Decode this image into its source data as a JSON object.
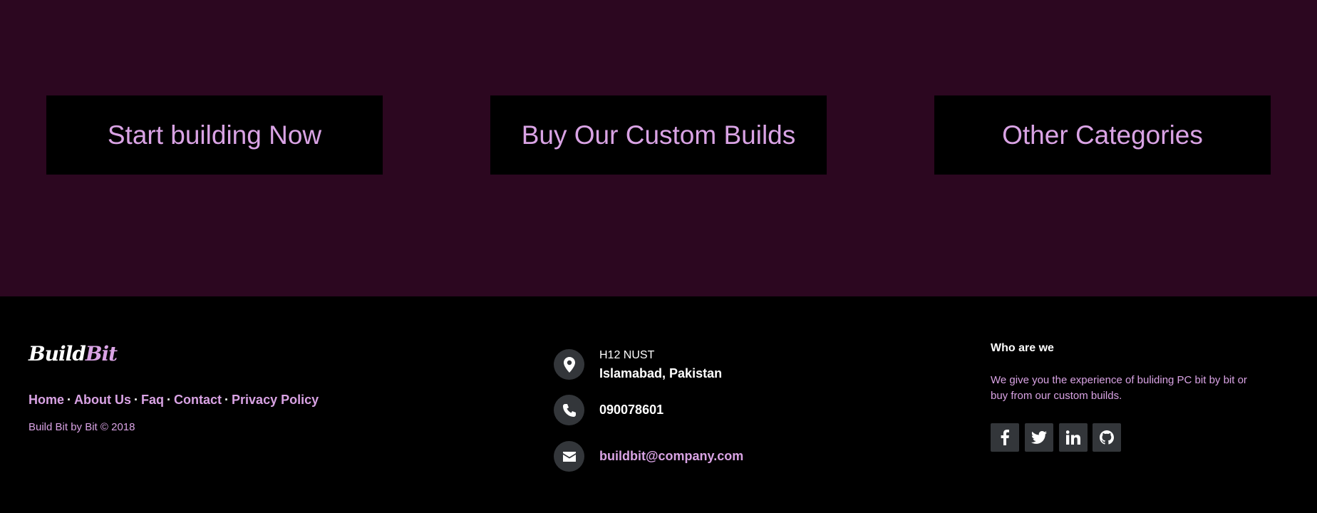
{
  "hero": {
    "buttons": [
      {
        "label": "Start building Now"
      },
      {
        "label": "Buy Our Custom Builds"
      },
      {
        "label": "Other Categories"
      }
    ]
  },
  "footer": {
    "brand": {
      "part1": "Build",
      "part2": "Bit"
    },
    "links": [
      {
        "label": "Home"
      },
      {
        "label": "About Us"
      },
      {
        "label": "Faq"
      },
      {
        "label": "Contact"
      },
      {
        "label": "Privacy Policy"
      }
    ],
    "separator": "·",
    "copyright": "Build Bit by Bit © 2018",
    "contact": {
      "address_line1": "H12 NUST",
      "address_line2": "Islamabad, Pakistan",
      "phone": "090078601",
      "email": "buildbit@company.com"
    },
    "about": {
      "title": "Who are we",
      "text": "We give you the experience of buliding PC bit by bit or buy from our custom builds."
    },
    "social_icons": [
      "facebook-icon",
      "twitter-icon",
      "linkedin-icon",
      "github-icon"
    ]
  },
  "colors": {
    "hero_bg": "#2c0720",
    "accent": "#d9a3e4",
    "footer_bg": "#000000",
    "icon_bg": "#33363a"
  }
}
